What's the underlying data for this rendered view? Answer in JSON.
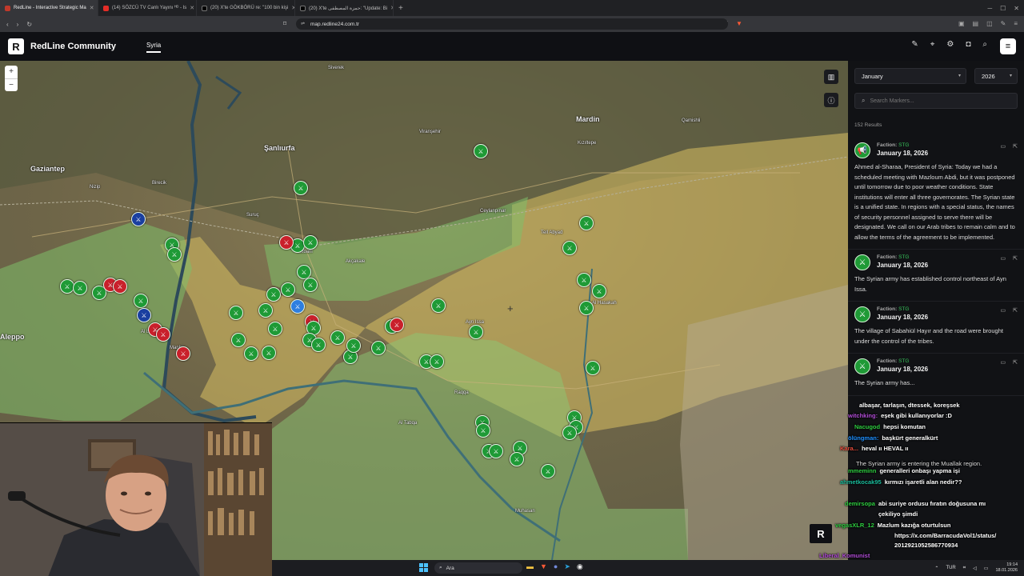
{
  "browser": {
    "tabs": [
      {
        "title": "RedLine - Interactive Strategic Ma",
        "active": true,
        "color": "#c0392b"
      },
      {
        "title": "(14) SÖZCÜ TV Canlı Yayını ᴴᴰ - Is",
        "active": false,
        "color": "#e52d27"
      },
      {
        "title": "(20) X'te GÖKBÖRÜ re: \"100 bin kişi",
        "active": false,
        "color": "#000000"
      },
      {
        "title": "(20) X'te حمزة المصطفى: \"Update: Bi",
        "active": false,
        "color": "#000000"
      }
    ],
    "url": "map.redline24.com.tr"
  },
  "app": {
    "logo_letter": "R",
    "brand": "RedLine Community",
    "region": "Syria"
  },
  "map": {
    "places": {
      "gaziantep": "Gaziantep",
      "sanliurfa": "Şanlıurfa",
      "mardin": "Mardin",
      "aleppo": "Aleppo",
      "nizip": "Nizip",
      "birecik": "Birecik",
      "suruc": "Suruç",
      "ceylanpinar": "Ceylanpınar",
      "kiziltepe": "Kızıltepe",
      "viransehir": "Viranşehir",
      "siverek": "Siverek",
      "akcakale": "Akçakale",
      "kobani": "Kobani",
      "ayn_issa": "Ayn Issa",
      "raqqa": "Raqqa",
      "hasakah": "Al Hasakah",
      "tell_abyad": "Tell Abyad",
      "manbij": "Manbij",
      "al_bab": "Al Bab",
      "tabqa": "Al Tabqa",
      "qamishli": "Qamishli",
      "deir": "Muhasan"
    },
    "zoom_in": "+",
    "zoom_out": "−"
  },
  "sidebar": {
    "month": "January",
    "year": "2026",
    "search_placeholder": "Search Markers...",
    "results": "152 Results",
    "entries": [
      {
        "faction_label": "Faction:",
        "faction": "STG",
        "date": "January 18, 2026",
        "text": "Ahmed al-Sharaa, President of Syria: Today we had a scheduled meeting with Mazloum Abdi, but it was postponed until tomorrow due to poor weather conditions. State institutions will enter all three governorates. The Syrian state is a unified state. In regions with a special status, the names of security personnel assigned to serve there will be designated. We call on our Arab tribes to remain calm and to allow the terms of the agreement to be implemented."
      },
      {
        "faction_label": "Faction:",
        "faction": "STG",
        "date": "January 18, 2026",
        "text": "The Syrian army has established control northeast of Ayn Issa."
      },
      {
        "faction_label": "Faction:",
        "faction": "STG",
        "date": "January 18, 2026",
        "text": "The village of Sabahiül Hayır and the road were brought under the control of the tribes."
      },
      {
        "faction_label": "Faction:",
        "faction": "STG",
        "date": "January 18, 2026",
        "text": "The Syrian army has..."
      }
    ]
  },
  "chat": [
    {
      "user": "",
      "msg": "albaşar, tarlaşın, dtessek, koreşsek",
      "color": "#ffffff"
    },
    {
      "user": "witchking:",
      "msg": "eşek gibi kullanıyorlar :D",
      "color": "#b14cd6"
    },
    {
      "user": "Nacugod",
      "msg": "hepsi komutan",
      "color": "#2ecc40"
    },
    {
      "user": "ölüngman:",
      "msg": "başkürt generalkürt",
      "color": "#1e90ff"
    },
    {
      "user": "Kara...",
      "msg": "heval ıı HEVAL ıı",
      "color": "#e74c3c"
    },
    {
      "user": "",
      "msg": "The Syrian army is entering the Muallak region.",
      "color": "#dddddd"
    },
    {
      "user": "mmeminn",
      "msg": "generalleri onbaşı yapma işi",
      "color": "#2ecc40"
    },
    {
      "user": "ahmetkocak95",
      "msg": "kırmızı işaretli alan nedir??",
      "color": "#1abc9c"
    },
    {
      "user": "demirsopa",
      "msg": "abi suriye ordusu fıratın doğusuna mı",
      "color": "#2ecc40"
    },
    {
      "user": "",
      "msg": "çekiliyo şimdi",
      "color": "#ffffff"
    },
    {
      "user": "vegasXLR_12",
      "msg": "Mazlum kazığa oturtulsun",
      "color": "#2ecc40"
    },
    {
      "user": "",
      "msg": "https://x.com/BarracudaVol1/status/",
      "color": "#ffffff"
    },
    {
      "user": "",
      "msg": "2012921052586770934",
      "color": "#ffffff"
    },
    {
      "user": "Liberal_Komunist",
      "msg": "",
      "color": "#b14cd6"
    }
  ],
  "taskbar": {
    "search": "Ara",
    "lang": "TUR",
    "time": "19:14",
    "date": "18.01.2026"
  },
  "colors": {
    "green_zone": "#7fbf6a",
    "yellow_zone": "#e7c96b",
    "government_marker": "#1f9a36",
    "sdf_marker": "#c9202b",
    "accent": "#37c55a"
  }
}
